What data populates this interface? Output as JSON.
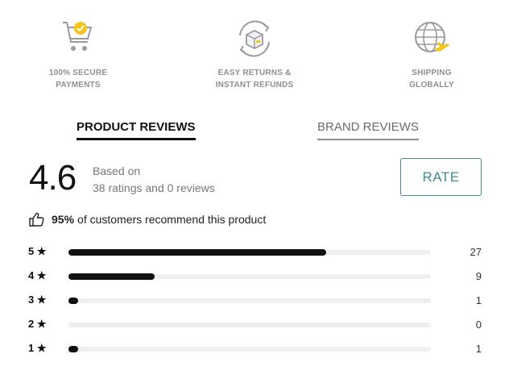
{
  "badges": [
    {
      "icon": "cart-check-icon",
      "line1": "100% SECURE",
      "line2": "PAYMENTS"
    },
    {
      "icon": "box-return-icon",
      "line1": "EASY RETURNS &",
      "line2": "INSTANT REFUNDS"
    },
    {
      "icon": "globe-plane-icon",
      "line1": "SHIPPING",
      "line2": "GLOBALLY"
    }
  ],
  "tabs": {
    "product": "PRODUCT REVIEWS",
    "brand": "BRAND REVIEWS"
  },
  "summary": {
    "score": "4.6",
    "based_on": "Based on",
    "ratings_text": "38 ratings and 0 reviews",
    "rate_label": "RATE"
  },
  "recommend": {
    "percent": "95%",
    "text": "of customers recommend this product"
  },
  "distribution": [
    {
      "label": "5 ★",
      "count": "27",
      "fraction": 0.711
    },
    {
      "label": "4 ★",
      "count": "9",
      "fraction": 0.237
    },
    {
      "label": "3 ★",
      "count": "1",
      "fraction": 0.026
    },
    {
      "label": "2 ★",
      "count": "0",
      "fraction": 0
    },
    {
      "label": "1 ★",
      "count": "1",
      "fraction": 0.026
    }
  ],
  "colors": {
    "accent": "#3f8f8c",
    "badge_yellow": "#f5c518",
    "bar": "#111111",
    "track": "#efefef"
  }
}
